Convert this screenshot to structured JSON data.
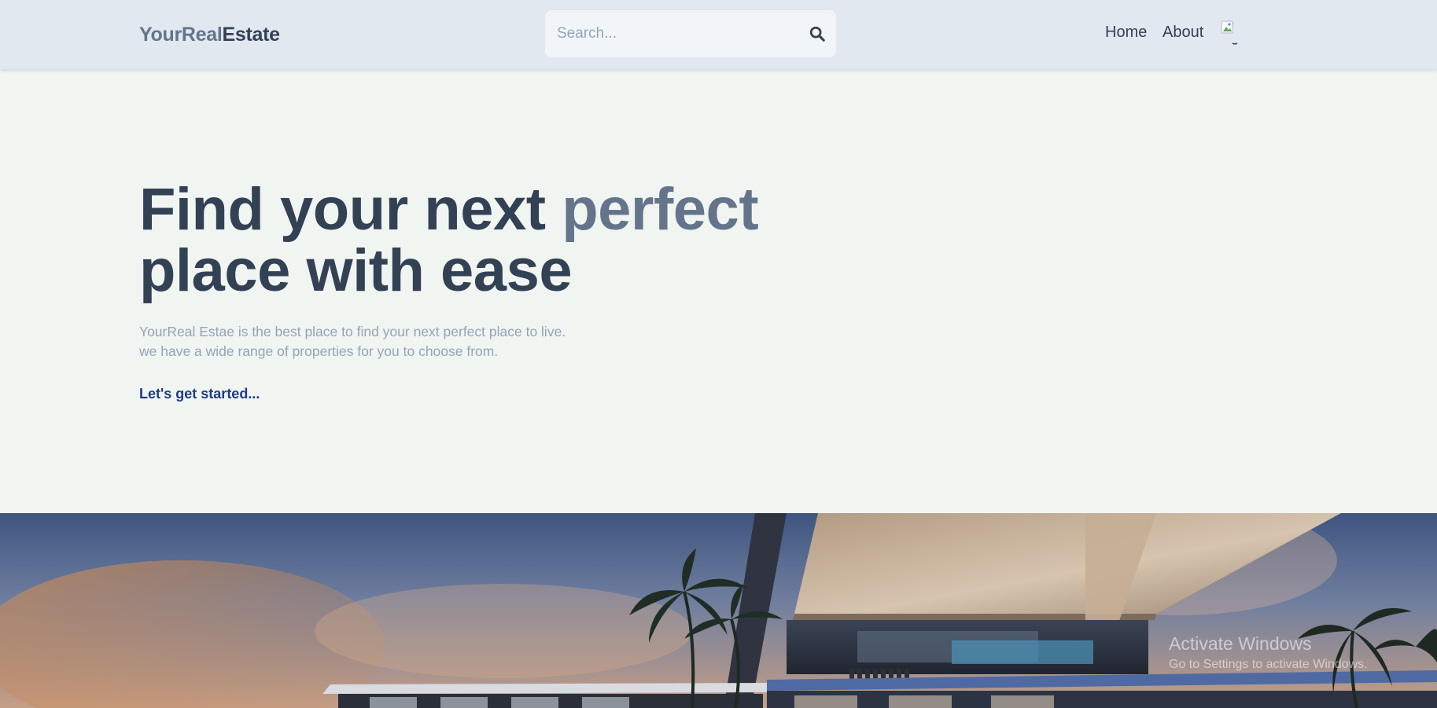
{
  "header": {
    "logo_part1": "YourReal",
    "logo_part2": "Estate",
    "search": {
      "placeholder": "Search...",
      "icon": "search-icon"
    },
    "nav": {
      "home": "Home",
      "about": "About"
    },
    "profile": {
      "icon": "broken-image-avatar-icon"
    }
  },
  "hero": {
    "title_line1_start": "Find your next ",
    "title_line1_accent": "perfect",
    "title_line2": "place with ease",
    "subtitle_line1": "YourReal Estae is the best place to find your next perfect place to live.",
    "subtitle_line2": "we have a wide range of properties for you to choose from.",
    "cta": "Let's get started..."
  },
  "watermark": {
    "title": "Activate Windows",
    "subtitle": "Go to Settings to activate Windows."
  },
  "colors": {
    "header_bg": "#e2e8f0",
    "page_bg": "#f1f5f1",
    "text_dark": "#334155",
    "text_accent": "#64748b",
    "text_muted": "#94a3b8",
    "cta": "#1e3a8a"
  }
}
